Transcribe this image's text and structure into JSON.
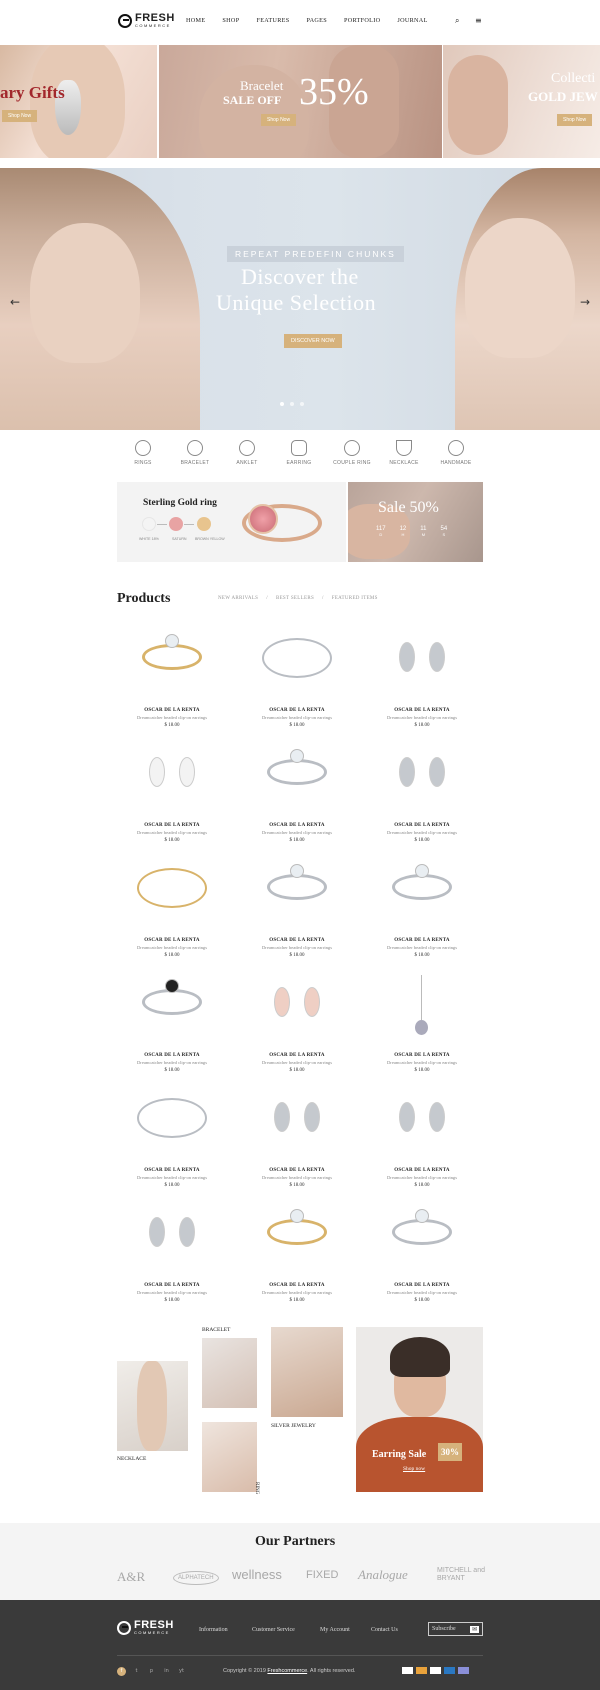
{
  "header": {
    "brand": "FRESH",
    "brand_sub": "COMMERCE",
    "nav": [
      "HOME",
      "SHOP",
      "FEATURES",
      "PAGES",
      "PORTFOLIO",
      "JOURNAL"
    ]
  },
  "promos": {
    "left_title": "ary Gifts",
    "left_button": "Shop Now",
    "center_pre": "Bracelet",
    "center_line": "SALE OFF",
    "center_pct": "35%",
    "center_button": "Shop Now",
    "right_title": "Collecti",
    "right_sub": "GOLD JEW",
    "right_button": "Shop Now"
  },
  "hero": {
    "tag": "REPEAT PREDEFIN CHUNKS",
    "title_1": "Discover the",
    "title_2": "Unique Selection",
    "button": "DISCOVER NOW",
    "prev": "←",
    "next": "→"
  },
  "categories": [
    "RINGS",
    "BRACELET",
    "ANKLET",
    "EARRING",
    "COUPLE RING",
    "NECKLACE",
    "HANDMADE"
  ],
  "feature": {
    "title": "Sterling Gold ring",
    "swatches": [
      "WHITE 18%",
      "SATURN",
      "BROWN YELLOW"
    ],
    "swatch_colors": [
      "#f4f4f4",
      "#e8a3a3",
      "#e8c48e"
    ],
    "sale_title": "Sale 50%",
    "countdown": [
      {
        "v": "117",
        "l": "D"
      },
      {
        "v": "12",
        "l": "H"
      },
      {
        "v": "11",
        "l": "M"
      },
      {
        "v": "54",
        "l": "S"
      }
    ]
  },
  "products": {
    "title": "Products",
    "filters": [
      "NEW ARRIVALS",
      "/",
      "BEST SELLERS",
      "/",
      "FEATURED ITEMS"
    ],
    "name": "OSCAR DE LA RENTA",
    "desc": "Dreamcatcher beaded clip-on earrings",
    "price": "$ 18.00"
  },
  "collage": {
    "bracelet": "BRACELET",
    "necklace": "NECKLACE",
    "silver": "SILVER JEWELRY",
    "ring": "RING",
    "sale_title": "Earring Sale",
    "sale_pct": "30%",
    "sale_button": "Shop now"
  },
  "partners": {
    "title": "Our Partners",
    "logos": [
      "A&R",
      "ALPHATECH",
      "wellness",
      "FIXED",
      "Analogue",
      "MITCHELL and BRYANT"
    ]
  },
  "footer": {
    "brand": "FRESH",
    "brand_sub": "COMMERCE",
    "links": [
      "Information",
      "Customer Service",
      "My Account",
      "Contact Us"
    ],
    "subscribe": "Subscribe",
    "copyright_pre": "Copyright © 2019",
    "copyright_brand": "Freshcommerce",
    "copyright_post": ". All rights reserved.",
    "social": [
      "f",
      "t",
      "p",
      "in",
      "yt"
    ]
  },
  "colors": {
    "accent": "#d6b27c",
    "sale_red": "#a2272c",
    "footer_bg": "#3a3a3a"
  }
}
